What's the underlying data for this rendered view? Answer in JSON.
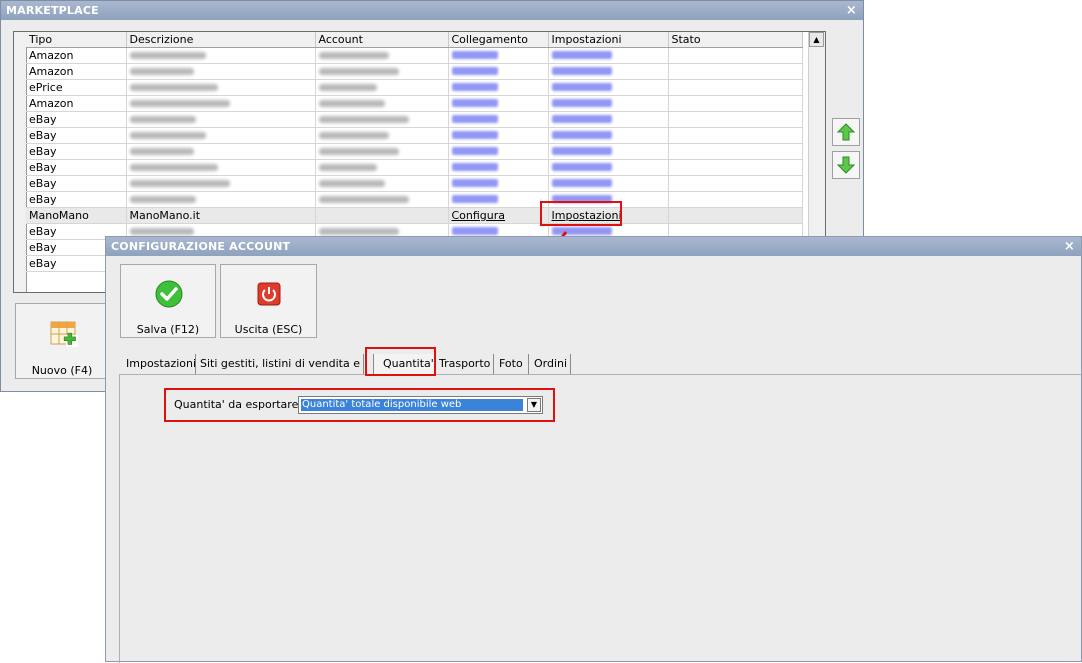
{
  "marketplace": {
    "title": "MARKETPLACE",
    "close": "×",
    "columns": [
      "Tipo",
      "Descrizione",
      "Account",
      "Collegamento",
      "Impostazioni",
      "Stato"
    ],
    "rows": [
      {
        "tipo": "Amazon"
      },
      {
        "tipo": "Amazon"
      },
      {
        "tipo": "ePrice"
      },
      {
        "tipo": "Amazon"
      },
      {
        "tipo": "eBay"
      },
      {
        "tipo": "eBay"
      },
      {
        "tipo": "eBay"
      },
      {
        "tipo": "eBay"
      },
      {
        "tipo": "eBay"
      },
      {
        "tipo": "eBay"
      },
      {
        "tipo": "ManoMano",
        "descrizione": "ManoMano.it",
        "collegamento": "Configura",
        "impostazioni": "Impostazioni"
      },
      {
        "tipo": "eBay"
      },
      {
        "tipo": "eBay"
      },
      {
        "tipo": "eBay"
      }
    ],
    "new_button": "Nuovo (F4)",
    "icons": {
      "up": "arrow-up-icon",
      "down": "arrow-down-icon",
      "new": "grid-add-icon"
    }
  },
  "config": {
    "title": "CONFIGURAZIONE ACCOUNT",
    "close": "×",
    "save_button": "Salva (F12)",
    "exit_button": "Uscita (ESC)",
    "tabs": [
      "Impostazioni",
      "Siti gestiti, listini di vendita e lingue",
      "Quantita'",
      "Trasporto",
      "Foto",
      "Ordini"
    ],
    "active_tab": "Quantita'",
    "field_label": "Quantita' da esportare :",
    "field_value": "Quantita' totale disponibile web",
    "icons": {
      "save": "check-icon",
      "exit": "power-icon"
    }
  },
  "colors": {
    "highlight": "#e01010",
    "selection": "#3a83d9"
  }
}
